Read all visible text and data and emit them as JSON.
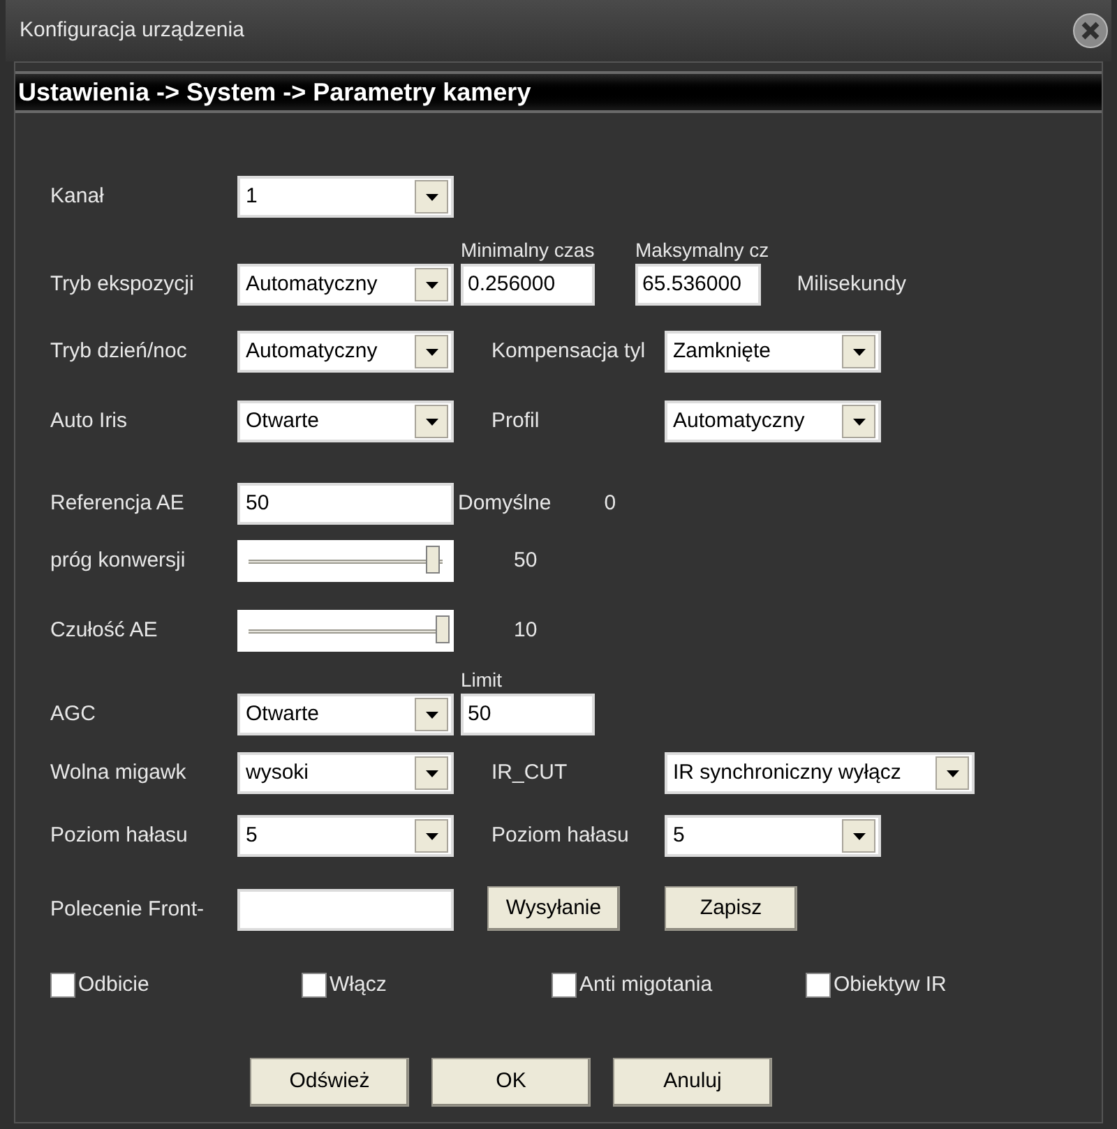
{
  "window": {
    "title": "Konfiguracja urządzenia"
  },
  "breadcrumb": "Ustawienia -> System -> Parametry kamery",
  "rows": [
    {
      "label": "Kanał",
      "fields": [
        {
          "kind": "select",
          "value": "1"
        }
      ]
    },
    {
      "label": "Tryb ekspozycji",
      "fields": [
        {
          "kind": "select",
          "value": "Automatyczny"
        },
        {
          "kind": "captioned-input",
          "caption": "Minimalny czas",
          "value": "0.256000"
        },
        {
          "kind": "captioned-input",
          "caption": "Maksymalny cz",
          "value": "65.536000"
        },
        {
          "kind": "text",
          "text": "Milisekundy"
        }
      ]
    },
    {
      "label": "Tryb dzień/noc",
      "fields": [
        {
          "kind": "select",
          "value": "Automatyczny"
        },
        {
          "kind": "label",
          "text": "Kompensacja tyl"
        },
        {
          "kind": "select",
          "value": "Zamknięte"
        }
      ]
    },
    {
      "label": "Auto Iris",
      "fields": [
        {
          "kind": "select",
          "value": "Otwarte"
        },
        {
          "kind": "label",
          "text": "Profil"
        },
        {
          "kind": "select",
          "value": "Automatyczny"
        }
      ]
    },
    {
      "label": "Referencja AE",
      "fields": [
        {
          "kind": "input",
          "value": "50"
        },
        {
          "kind": "text",
          "text": "Domyślne"
        },
        {
          "kind": "text",
          "text": "0"
        }
      ]
    },
    {
      "label": "próg konwersji",
      "fields": [
        {
          "kind": "slider",
          "level": 0.95
        },
        {
          "kind": "reading",
          "text": "50"
        }
      ]
    },
    {
      "label": "Czułość AE",
      "fields": [
        {
          "kind": "slider",
          "level": 1
        },
        {
          "kind": "reading",
          "text": "10"
        }
      ]
    },
    {
      "label": "AGC",
      "fields": [
        {
          "kind": "select",
          "value": "Otwarte"
        },
        {
          "kind": "captioned-input",
          "caption": "Limit",
          "value": "50"
        }
      ]
    },
    {
      "label": "Wolna migawk",
      "fields": [
        {
          "kind": "select",
          "value": "wysoki"
        },
        {
          "kind": "label",
          "text": "IR_CUT"
        },
        {
          "kind": "wide-select",
          "value": "IR synchroniczny wyłącz"
        }
      ]
    },
    {
      "label": "Poziom hałasu",
      "fields": [
        {
          "kind": "select",
          "value": "5"
        },
        {
          "kind": "label",
          "text": "Poziom hałasu"
        },
        {
          "kind": "select",
          "value": "5"
        }
      ]
    },
    {
      "label": "Polecenie Front-",
      "fields": [
        {
          "kind": "input"
        },
        {
          "kind": "button",
          "text": "Wysyłanie"
        },
        {
          "kind": "button",
          "text": "Zapisz"
        }
      ]
    }
  ],
  "checkboxes": [
    {
      "label": "Odbicie",
      "checked": false
    },
    {
      "label": "Włącz",
      "checked": false
    },
    {
      "label": "Anti migotania",
      "checked": false
    },
    {
      "label": "Obiektyw IR",
      "checked": false
    }
  ],
  "buttons": [
    "Odśwież",
    "OK",
    "Anuluj"
  ]
}
